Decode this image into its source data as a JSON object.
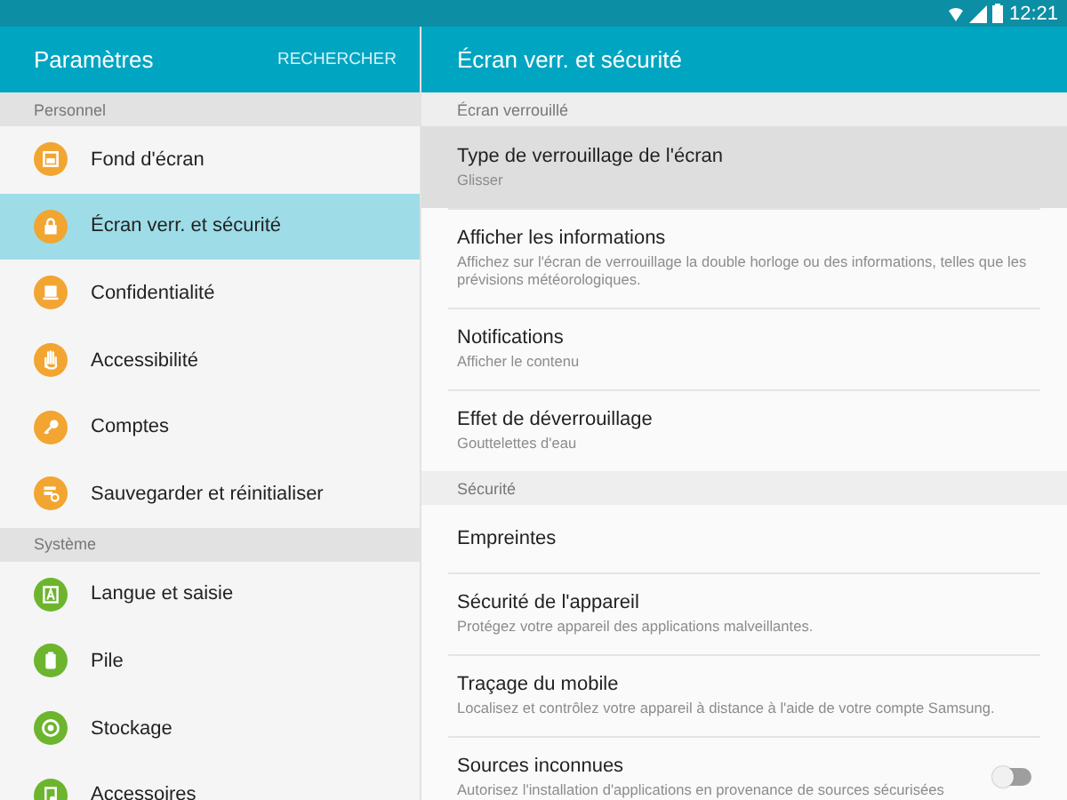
{
  "status_bar": {
    "time": "12:21"
  },
  "sidebar": {
    "title": "Paramètres",
    "search": "RECHERCHER",
    "sections": [
      {
        "header": "Personnel",
        "items": [
          {
            "label": "Fond d'écran",
            "selected": false,
            "color": "#f2a530"
          },
          {
            "label": "Écran verr. et sécurité",
            "selected": true,
            "color": "#f2a530"
          },
          {
            "label": "Confidentialité",
            "selected": false,
            "color": "#f2a530"
          },
          {
            "label": "Accessibilité",
            "selected": false,
            "color": "#f2a530"
          },
          {
            "label": "Comptes",
            "selected": false,
            "color": "#f2a530"
          },
          {
            "label": "Sauvegarder et réinitialiser",
            "selected": false,
            "color": "#f2a530"
          }
        ]
      },
      {
        "header": "Système",
        "items": [
          {
            "label": "Langue et saisie",
            "selected": false,
            "color": "#6cb52d"
          },
          {
            "label": "Pile",
            "selected": false,
            "color": "#6cb52d"
          },
          {
            "label": "Stockage",
            "selected": false,
            "color": "#6cb52d"
          },
          {
            "label": "Accessoires",
            "selected": false,
            "color": "#6cb52d"
          }
        ]
      }
    ]
  },
  "detail": {
    "title": "Écran verr. et sécurité",
    "sections": [
      {
        "header": "Écran verrouillé",
        "rows": [
          {
            "kind": "text",
            "title": "Type de verrouillage de l'écran",
            "subtitle": "Glisser",
            "selected": true
          },
          {
            "kind": "text",
            "title": "Afficher les informations",
            "subtitle": "Affichez sur l'écran de verrouillage la double horloge ou des informations, telles que les prévisions météorologiques.",
            "selected": false
          },
          {
            "kind": "text",
            "title": "Notifications",
            "subtitle": "Afficher le contenu",
            "selected": false
          },
          {
            "kind": "text",
            "title": "Effet de déverrouillage",
            "subtitle": "Gouttelettes d'eau",
            "selected": false
          }
        ]
      },
      {
        "header": "Sécurité",
        "rows": [
          {
            "kind": "text",
            "title": "Empreintes",
            "selected": false
          },
          {
            "kind": "text",
            "title": "Sécurité de l'appareil",
            "subtitle": "Protégez votre appareil des applications malveillantes.",
            "selected": false
          },
          {
            "kind": "text",
            "title": "Traçage du mobile",
            "subtitle": "Localisez et contrôlez votre appareil à distance à l'aide de votre compte Samsung.",
            "selected": false
          },
          {
            "kind": "switch",
            "title": "Sources inconnues",
            "subtitle": "Autorisez l'installation d'applications en provenance de sources sécurisées",
            "on": false,
            "selected": false
          }
        ]
      }
    ]
  }
}
